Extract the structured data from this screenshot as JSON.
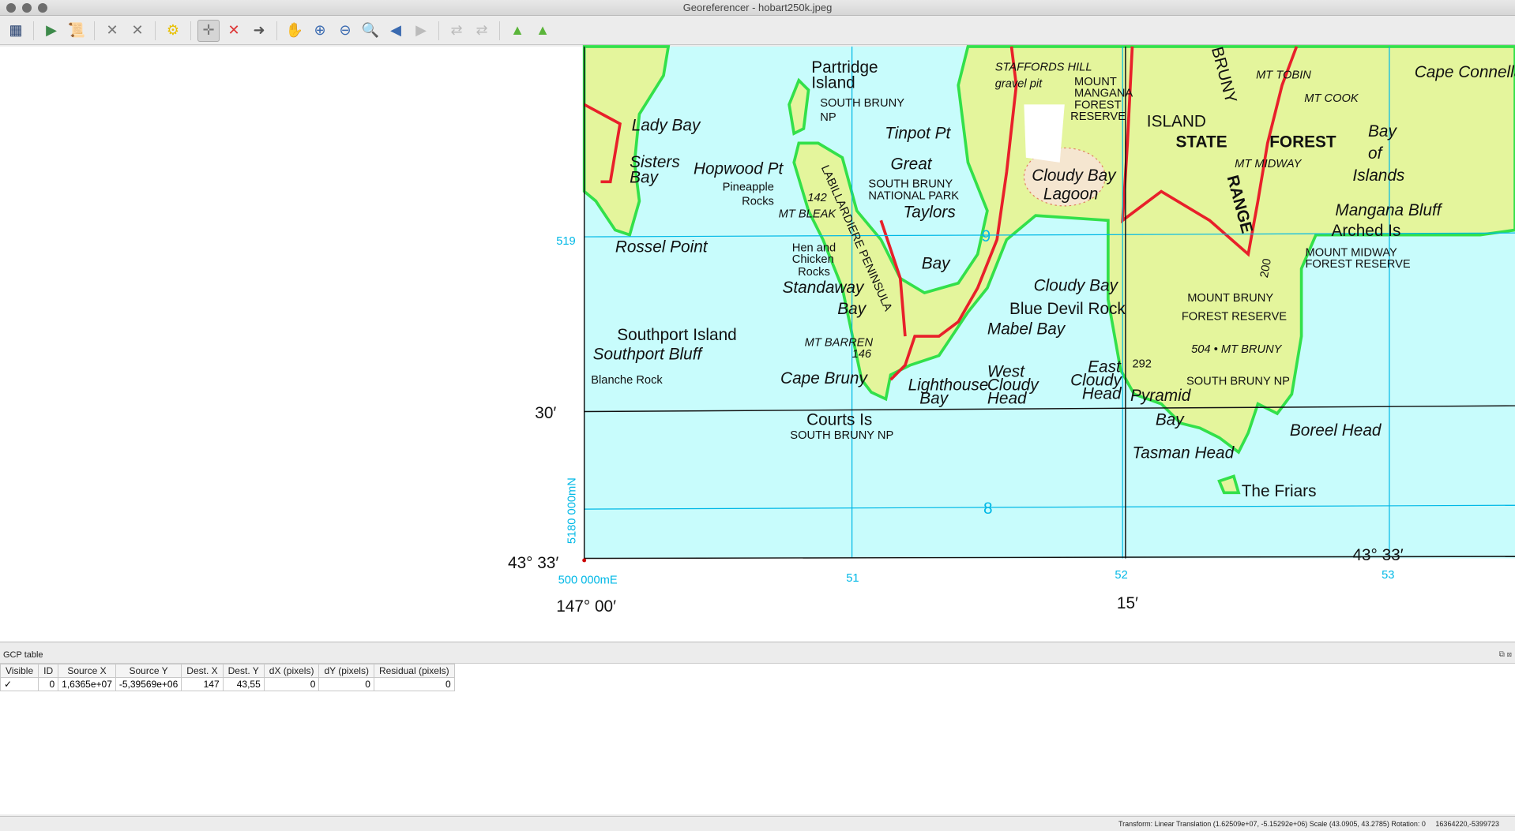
{
  "window": {
    "title": "Georeferencer - hobart250k.jpeg"
  },
  "toolbar": {
    "buttons": [
      "open-raster",
      "start-georeferencing",
      "generate-gdal-script",
      "load-gcp-points",
      "save-gcp-points",
      "transformation-settings",
      "add-point",
      "delete-point",
      "move-gcp-point",
      "pan",
      "zoom-in",
      "zoom-out",
      "zoom-to-layer",
      "zoom-last",
      "zoom-next",
      "link-georeferencer-to-qgis",
      "link-qgis-to-georeferencer",
      "full-histogram-stretch",
      "local-histogram-stretch"
    ],
    "active": "add-point"
  },
  "map": {
    "labels": {
      "partridge": "Partridge",
      "island": "Island",
      "south_bruny1": "SOUTH BRUNY",
      "np": "NP",
      "lady_bay": "Lady Bay",
      "sisters": "Sisters",
      "bay1": "Bay",
      "hopwood": "Hopwood Pt",
      "pineapple": "Pineapple",
      "rocks": "Rocks",
      "h142": "142",
      "mt_bleak": "MT BLEAK",
      "tinpot": "Tinpot Pt",
      "great": "Great",
      "sbnp1": "SOUTH BRUNY",
      "sbnp2": "NATIONAL PARK",
      "taylors": "Taylors",
      "bay_t": "Bay",
      "labillardiere": "LABILLARDIERE PENINSULA",
      "rossel": "Rossel Point",
      "hen": "Hen and",
      "chicken": "Chicken",
      "rocks2": "Rocks",
      "standaway": "Standaway",
      "bay_s": "Bay",
      "southport_is": "Southport Island",
      "southport_bl": "Southport Bluff",
      "blanche": "Blanche Rock",
      "mt_barren": "MT BARREN",
      "h146": "146",
      "cape_bruny": "Cape Bruny",
      "lighthouse": "Lighthouse",
      "bay_l": "Bay",
      "courts": "Courts Is",
      "courts_np": "SOUTH BRUNY NP",
      "stafford": "STAFFORDS HILL",
      "gravel": "gravel pit",
      "mount_mangana": "MOUNT",
      "mangana": "MANGANA",
      "forest": "FOREST",
      "reserve": "RESERVE",
      "cloudy_lagoon": "Cloudy Bay",
      "lagoon": "Lagoon",
      "cloudy_bay": "Cloudy Bay",
      "blue_devil": "Blue Devil Rock",
      "mabel": "Mabel Bay",
      "west": "West",
      "cloudy": "Cloudy",
      "head": "Head",
      "east": "East",
      "cloudy2": "Cloudy",
      "head2": "Head",
      "h292": "292",
      "pyramid": "Pyramid",
      "bay_p": "Bay",
      "bruny": "BRUNY",
      "island_big": "ISLAND",
      "state": "STATE",
      "forest_big": "FOREST",
      "range": "RANGE",
      "mt_tobin": "MT TOBIN",
      "mt_cook": "MT COOK",
      "mt_midway": "MT MIDWAY",
      "cape_connella": "Cape Connella",
      "bay_of": "Bay",
      "of": "of",
      "islands": "Islands",
      "mangana_bluff": "Mangana Bluff",
      "arched": "Arched Is",
      "mm_fr": "MOUNT MIDWAY",
      "mm_fr2": "FOREST RESERVE",
      "mb_fr": "MOUNT BRUNY",
      "mb_fr2": "FOREST RESERVE",
      "mt_bruny": "504 • MT BRUNY",
      "sbnp3": "SOUTH BRUNY NP",
      "tasman": "Tasman Head",
      "boreel": "Boreel Head",
      "friars": "The Friars",
      "h200": "200",
      "h9": "9",
      "h8": "8"
    },
    "margin": {
      "lat_30": "30′",
      "lat_33_left": "43° 33′",
      "lat_33_right": "43° 33′",
      "lon_00": "147° 00′",
      "lon_15": "15′",
      "grid_519": "519",
      "grid_5180": "5180 000mN",
      "grid_500": "500 000mE",
      "grid_51": "51",
      "grid_52": "52",
      "grid_53": "53"
    }
  },
  "gcp_table": {
    "title": "GCP table",
    "columns": [
      "Visible",
      "ID",
      "Source X",
      "Source Y",
      "Dest. X",
      "Dest. Y",
      "dX (pixels)",
      "dY (pixels)",
      "Residual (pixels)"
    ],
    "rows": [
      {
        "visible": "✓",
        "id": "0",
        "source_x": "1,6365e+07",
        "source_y": "-5,39569e+06",
        "dest_x": "147",
        "dest_y": "43,55",
        "dx": "0",
        "dy": "0",
        "residual": "0"
      }
    ]
  },
  "status": {
    "transform": "Transform: Linear Translation (1.62509e+07, -5.15292e+06) Scale (43.0905, 43.2785) Rotation: 0",
    "coords": "16364220,-5399723"
  },
  "colors": {
    "water": "#c8fcfc",
    "land": "#e4f59c",
    "np_border": "#33e04a",
    "road": "#e8202a",
    "contour": "#c86432",
    "grid": "#00b8e6"
  }
}
